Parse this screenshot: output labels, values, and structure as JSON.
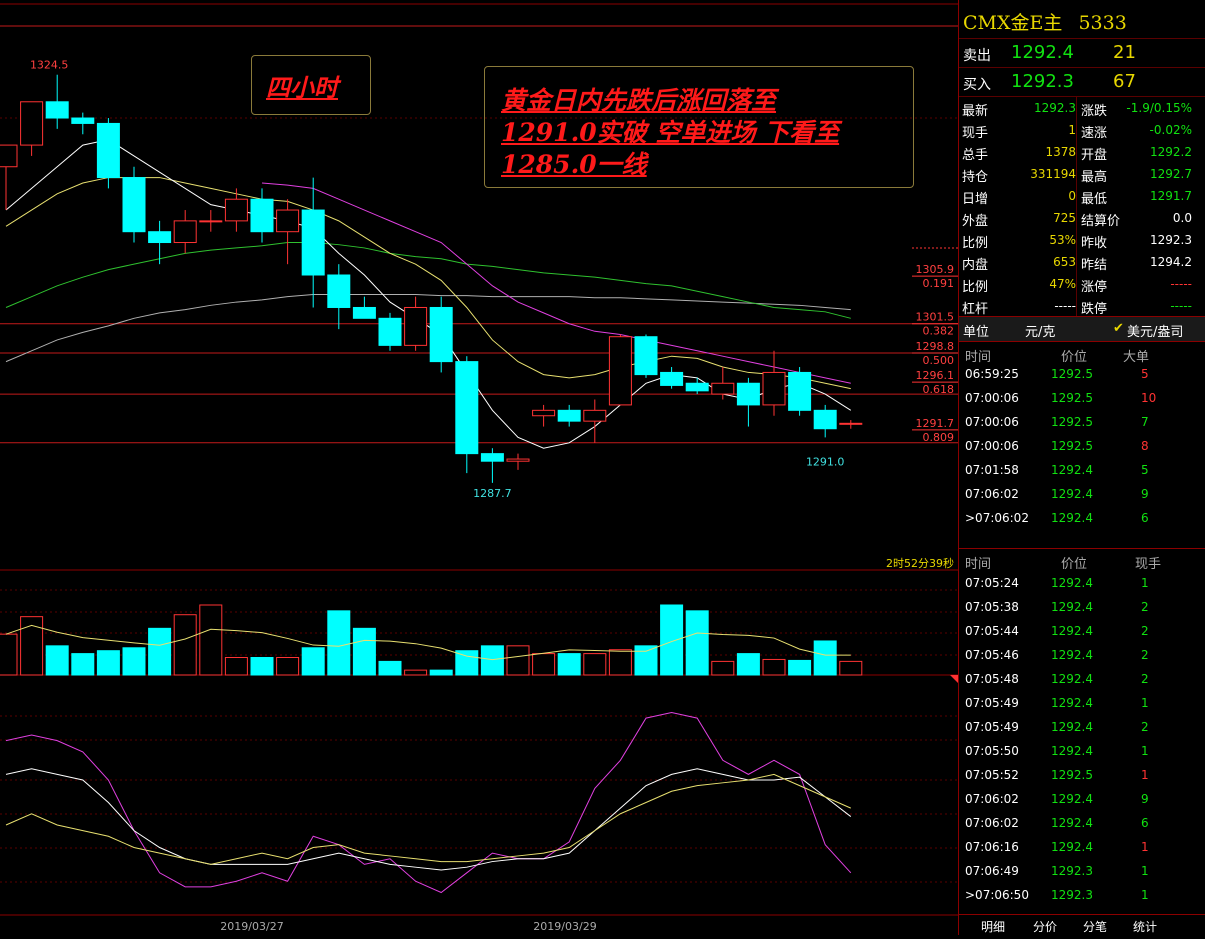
{
  "chart_data": {
    "type": "candlestick",
    "period_label": "四小时",
    "annotation": [
      "黄金日内先跌后涨回落至",
      "1291.0实破 空单进场 下看至",
      "1285.0一线"
    ],
    "high_label": "1324.5",
    "low_label": "1287.7",
    "last_low_label": "1291.0",
    "countdown": "2时52分39秒",
    "x_labels": [
      "2019/03/27",
      "2019/03/29"
    ],
    "ylim": [
      1283,
      1329
    ],
    "candles": [
      {
        "o": 1316,
        "h": 1318,
        "l": 1312,
        "c": 1318
      },
      {
        "o": 1318,
        "h": 1322,
        "l": 1317,
        "c": 1322
      },
      {
        "o": 1322,
        "h": 1324.5,
        "l": 1319.5,
        "c": 1320.5
      },
      {
        "o": 1320.5,
        "h": 1321,
        "l": 1319,
        "c": 1320
      },
      {
        "o": 1320,
        "h": 1320.5,
        "l": 1314,
        "c": 1315
      },
      {
        "o": 1315,
        "h": 1316,
        "l": 1309,
        "c": 1310
      },
      {
        "o": 1310,
        "h": 1311,
        "l": 1307,
        "c": 1309
      },
      {
        "o": 1309,
        "h": 1312,
        "l": 1308,
        "c": 1311
      },
      {
        "o": 1311,
        "h": 1312,
        "l": 1310,
        "c": 1311
      },
      {
        "o": 1311,
        "h": 1314,
        "l": 1310,
        "c": 1313
      },
      {
        "o": 1313,
        "h": 1314,
        "l": 1309,
        "c": 1310
      },
      {
        "o": 1310,
        "h": 1313,
        "l": 1307,
        "c": 1312
      },
      {
        "o": 1312,
        "h": 1315,
        "l": 1303,
        "c": 1306
      },
      {
        "o": 1306,
        "h": 1307,
        "l": 1301,
        "c": 1303
      },
      {
        "o": 1303,
        "h": 1304,
        "l": 1302,
        "c": 1302
      },
      {
        "o": 1302,
        "h": 1302.5,
        "l": 1299,
        "c": 1299.5
      },
      {
        "o": 1299.5,
        "h": 1304,
        "l": 1299,
        "c": 1303
      },
      {
        "o": 1303,
        "h": 1304,
        "l": 1297,
        "c": 1298
      },
      {
        "o": 1298,
        "h": 1298.5,
        "l": 1287.7,
        "c": 1289.5
      },
      {
        "o": 1289.5,
        "h": 1290,
        "l": 1286.8,
        "c": 1288.8
      },
      {
        "o": 1288.8,
        "h": 1289.5,
        "l": 1288,
        "c": 1289
      },
      {
        "o": 1293,
        "h": 1294,
        "l": 1292,
        "c": 1293.5
      },
      {
        "o": 1293.5,
        "h": 1294,
        "l": 1292,
        "c": 1292.5
      },
      {
        "o": 1292.5,
        "h": 1294.5,
        "l": 1290.5,
        "c": 1293.5
      },
      {
        "o": 1294,
        "h": 1300.5,
        "l": 1294,
        "c": 1300.3
      },
      {
        "o": 1300.3,
        "h": 1300.5,
        "l": 1296.5,
        "c": 1296.8
      },
      {
        "o": 1297,
        "h": 1297.5,
        "l": 1295.5,
        "c": 1295.8
      },
      {
        "o": 1296,
        "h": 1296.5,
        "l": 1295,
        "c": 1295.3
      },
      {
        "o": 1295,
        "h": 1297.5,
        "l": 1294.5,
        "c": 1296
      },
      {
        "o": 1296,
        "h": 1296.5,
        "l": 1292,
        "c": 1294
      },
      {
        "o": 1294,
        "h": 1299,
        "l": 1293,
        "c": 1297
      },
      {
        "o": 1297,
        "h": 1297.5,
        "l": 1293,
        "c": 1293.5
      },
      {
        "o": 1293.5,
        "h": 1294,
        "l": 1291,
        "c": 1291.8
      },
      {
        "o": 1292.3,
        "h": 1292.6,
        "l": 1291.8,
        "c": 1292.3
      }
    ],
    "ma_white": [
      1312,
      1314,
      1316,
      1318,
      1318.5,
      1317,
      1315.5,
      1314,
      1312.5,
      1312,
      1311.5,
      1311,
      1310.3,
      1308,
      1306,
      1303.5,
      1302,
      1300.5,
      1297,
      1293.5,
      1291,
      1290,
      1290.5,
      1292,
      1294,
      1296,
      1296.8,
      1296.5,
      1295,
      1294.5,
      1295.5,
      1296,
      1295,
      1293.5
    ],
    "ma_yellow": [
      1310.5,
      1312,
      1313.5,
      1314.5,
      1315,
      1315,
      1315,
      1314.5,
      1314,
      1313.5,
      1313,
      1312.8,
      1312,
      1311,
      1309.5,
      1308,
      1307,
      1305.5,
      1303,
      1300,
      1298,
      1296.8,
      1296.5,
      1296.8,
      1297.5,
      1298,
      1298.5,
      1298.3,
      1297.5,
      1297,
      1296.8,
      1296.5,
      1296,
      1295.5
    ],
    "ma_magenta": [
      null,
      null,
      null,
      null,
      null,
      null,
      null,
      null,
      null,
      null,
      1314.5,
      1314.3,
      1314,
      1313,
      1312,
      1311,
      1310,
      1309,
      1307,
      1305,
      1303.5,
      1302.5,
      1301.5,
      1300.8,
      1300.5,
      1300,
      1299.5,
      1299,
      1298.5,
      1298,
      1297.5,
      1297,
      1296.5,
      1296
    ],
    "ma_green": [
      1303,
      1304,
      1305,
      1305.8,
      1306.5,
      1307,
      1307.5,
      1308,
      1308.3,
      1308.5,
      1308.7,
      1309,
      1309,
      1308.8,
      1308.5,
      1308,
      1307.7,
      1307.5,
      1307,
      1306.8,
      1306.5,
      1306.2,
      1306,
      1305.8,
      1305.5,
      1305.2,
      1305,
      1304.5,
      1304,
      1303.5,
      1303,
      1302.8,
      1302.6,
      1302
    ],
    "ma_gray": [
      1298,
      1299,
      1300,
      1300.7,
      1301.3,
      1302,
      1302.5,
      1302.8,
      1303.2,
      1303.5,
      1303.7,
      1304,
      1304.2,
      1304.2,
      1304.2,
      1304.2,
      1304.2,
      1304.1,
      1304.1,
      1304,
      1304,
      1304,
      1304,
      1303.9,
      1303.9,
      1303.8,
      1303.7,
      1303.6,
      1303.5,
      1303.4,
      1303.3,
      1303.2,
      1303,
      1302.8
    ],
    "fib_levels": [
      {
        "price": "1305.9",
        "ratio": "0.191",
        "y": 1305.9
      },
      {
        "price": "1301.5",
        "ratio": "0.382",
        "y": 1301.5
      },
      {
        "price": "1298.8",
        "ratio": "0.500",
        "y": 1298.8
      },
      {
        "price": "1296.1",
        "ratio": "0.618",
        "y": 1296.1
      },
      {
        "price": "1291.7",
        "ratio": "0.809",
        "y": 1291.7
      }
    ],
    "horizontal_lines": [
      1329,
      1301.5,
      1298.8,
      1295,
      1290.5
    ],
    "volume": [
      42,
      60,
      30,
      22,
      25,
      28,
      48,
      62,
      72,
      18,
      18,
      18,
      28,
      66,
      48,
      14,
      5,
      5,
      25,
      30,
      30,
      22,
      22,
      22,
      26,
      30,
      72,
      66,
      14,
      22,
      16,
      15,
      35,
      14
    ],
    "kd": {
      "k": [
        62,
        64,
        62,
        58,
        48,
        30,
        15,
        10,
        10,
        12,
        15,
        12,
        28,
        25,
        18,
        20,
        12,
        8,
        15,
        22,
        20,
        20,
        26,
        45,
        55,
        70,
        72,
        70,
        55,
        50,
        55,
        50,
        25,
        15
      ],
      "d": [
        50,
        52,
        50,
        48,
        40,
        30,
        24,
        20,
        18,
        18,
        18,
        18,
        20,
        22,
        20,
        18,
        17,
        16,
        17,
        19,
        20,
        20,
        22,
        30,
        38,
        46,
        50,
        52,
        50,
        48,
        48,
        49,
        42,
        35
      ],
      "j": [
        32,
        36,
        32,
        30,
        28,
        24,
        22,
        20,
        18,
        20,
        22,
        20,
        24,
        25,
        22,
        21,
        20,
        19,
        19,
        20,
        21,
        22,
        24,
        30,
        36,
        40,
        44,
        46,
        47,
        48,
        50,
        46,
        42,
        38
      ]
    }
  },
  "panel": {
    "title": "CMX金E主",
    "code": "5333",
    "sell_label": "卖出",
    "sell_price": "1292.4",
    "sell_vol": "21",
    "buy_label": "买入",
    "buy_price": "1292.3",
    "buy_vol": "67",
    "quotes": [
      {
        "k1": "最新",
        "v1": "1292.3",
        "c1": "#11e111",
        "k2": "涨跌",
        "v2": "-1.9/0.15%",
        "c2": "#11e111"
      },
      {
        "k1": "现手",
        "v1": "1",
        "c1": "#e8d700",
        "k2": "速涨",
        "v2": "-0.02%",
        "c2": "#11e111"
      },
      {
        "k1": "总手",
        "v1": "1378",
        "c1": "#e8d700",
        "k2": "开盘",
        "v2": "1292.2",
        "c2": "#11e111"
      },
      {
        "k1": "持仓",
        "v1": "331194",
        "c1": "#e8d700",
        "k2": "最高",
        "v2": "1292.7",
        "c2": "#11e111"
      },
      {
        "k1": "日增",
        "v1": "0",
        "c1": "#e8d700",
        "k2": "最低",
        "v2": "1291.7",
        "c2": "#11e111"
      },
      {
        "k1": "外盘",
        "v1": "725",
        "c1": "#e8d700",
        "k2": "结算价",
        "v2": "0.0",
        "c2": "#ffffff"
      },
      {
        "k1": "比例",
        "v1": "53%",
        "c1": "#e8d700",
        "k2": "昨收",
        "v2": "1292.3",
        "c2": "#ffffff"
      },
      {
        "k1": "内盘",
        "v1": "653",
        "c1": "#e8d700",
        "k2": "昨结",
        "v2": "1294.2",
        "c2": "#ffffff"
      },
      {
        "k1": "比例",
        "v1": "47%",
        "c1": "#e8d700",
        "k2": "涨停",
        "v2": "-----",
        "c2": "#ff3333"
      },
      {
        "k1": "杠杆",
        "v1": "-----",
        "c1": "#ffffff",
        "k2": "跌停",
        "v2": "-----",
        "c2": "#11e111"
      }
    ],
    "unit_label": "单位",
    "unit_value": "元/克",
    "unit_alt": "美元/盎司",
    "big_hdr": {
      "time": "时间",
      "price": "价位",
      "vol": "大单"
    },
    "big_rows": [
      {
        "t": "06:59:25",
        "p": "1292.5",
        "v": "5",
        "c": "#ff3333"
      },
      {
        "t": "07:00:06",
        "p": "1292.5",
        "v": "10",
        "c": "#ff3333"
      },
      {
        "t": "07:00:06",
        "p": "1292.5",
        "v": "7",
        "c": "#11e111"
      },
      {
        "t": "07:00:06",
        "p": "1292.5",
        "v": "8",
        "c": "#ff3333"
      },
      {
        "t": "07:01:58",
        "p": "1292.4",
        "v": "5",
        "c": "#11e111"
      },
      {
        "t": "07:06:02",
        "p": "1292.4",
        "v": "9",
        "c": "#11e111"
      },
      {
        "t": ">07:06:02",
        "p": "1292.4",
        "v": "6",
        "c": "#11e111"
      }
    ],
    "tick_hdr": {
      "time": "时间",
      "price": "价位",
      "vol": "现手"
    },
    "tick_rows": [
      {
        "t": "07:05:24",
        "p": "1292.4",
        "v": "1",
        "c": "#11e111"
      },
      {
        "t": "07:05:38",
        "p": "1292.4",
        "v": "2",
        "c": "#11e111"
      },
      {
        "t": "07:05:44",
        "p": "1292.4",
        "v": "2",
        "c": "#11e111"
      },
      {
        "t": "07:05:46",
        "p": "1292.4",
        "v": "2",
        "c": "#11e111"
      },
      {
        "t": "07:05:48",
        "p": "1292.4",
        "v": "2",
        "c": "#11e111"
      },
      {
        "t": "07:05:49",
        "p": "1292.4",
        "v": "1",
        "c": "#11e111"
      },
      {
        "t": "07:05:49",
        "p": "1292.4",
        "v": "2",
        "c": "#11e111"
      },
      {
        "t": "07:05:50",
        "p": "1292.4",
        "v": "1",
        "c": "#11e111"
      },
      {
        "t": "07:05:52",
        "p": "1292.5",
        "v": "1",
        "c": "#ff3333"
      },
      {
        "t": "07:06:02",
        "p": "1292.4",
        "v": "9",
        "c": "#11e111"
      },
      {
        "t": "07:06:02",
        "p": "1292.4",
        "v": "6",
        "c": "#11e111"
      },
      {
        "t": "07:06:16",
        "p": "1292.4",
        "v": "1",
        "c": "#ff3333"
      },
      {
        "t": "07:06:49",
        "p": "1292.3",
        "v": "1",
        "c": "#11e111"
      },
      {
        "t": ">07:06:50",
        "p": "1292.3",
        "v": "1",
        "c": "#11e111"
      }
    ],
    "tabs": [
      "明细",
      "分价",
      "分笔",
      "统计"
    ]
  },
  "colors": {
    "up": "#ff3333",
    "down": "#00ffff",
    "bg": "#000000",
    "grid": "#5a0000"
  }
}
